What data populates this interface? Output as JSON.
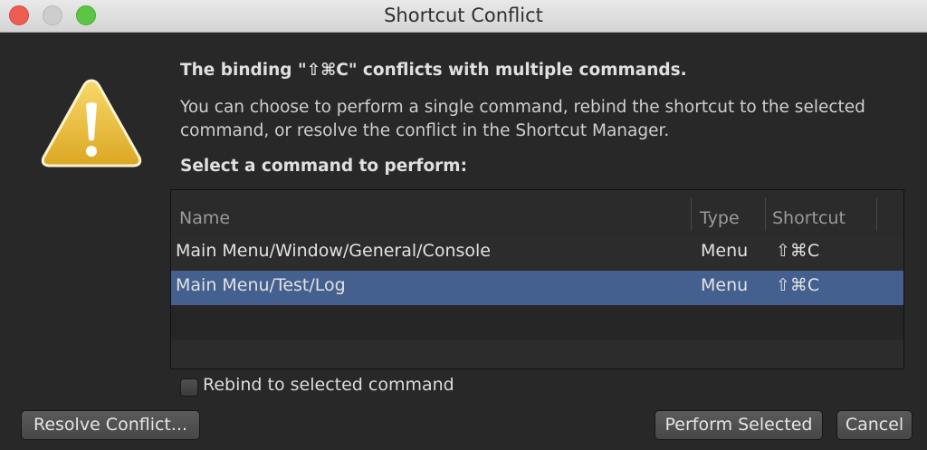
{
  "window": {
    "title": "Shortcut Conflict"
  },
  "message": {
    "heading": "The binding \"⇧⌘C\" conflicts with multiple commands.",
    "description": "You can choose to perform a single command, rebind the shortcut to the selected command, or resolve the conflict in the Shortcut Manager.",
    "select_label": "Select a command to perform:"
  },
  "table": {
    "columns": [
      "Name",
      "Type",
      "Shortcut"
    ],
    "rows": [
      {
        "name": "Main Menu/Window/General/Console",
        "type": "Menu",
        "shortcut": "⇧⌘C"
      },
      {
        "name": "Main Menu/Test/Log",
        "type": "Menu",
        "shortcut": "⇧⌘C"
      }
    ],
    "selected_row": 1
  },
  "rebind": {
    "label": "Rebind to selected command",
    "checked": false
  },
  "buttons": {
    "resolve": "Resolve Conflict...",
    "perform": "Perform Selected",
    "cancel": "Cancel"
  },
  "icons": {
    "warning": "warning-icon"
  },
  "colors": {
    "selection": "#44608f",
    "warning": "#f2c230"
  }
}
